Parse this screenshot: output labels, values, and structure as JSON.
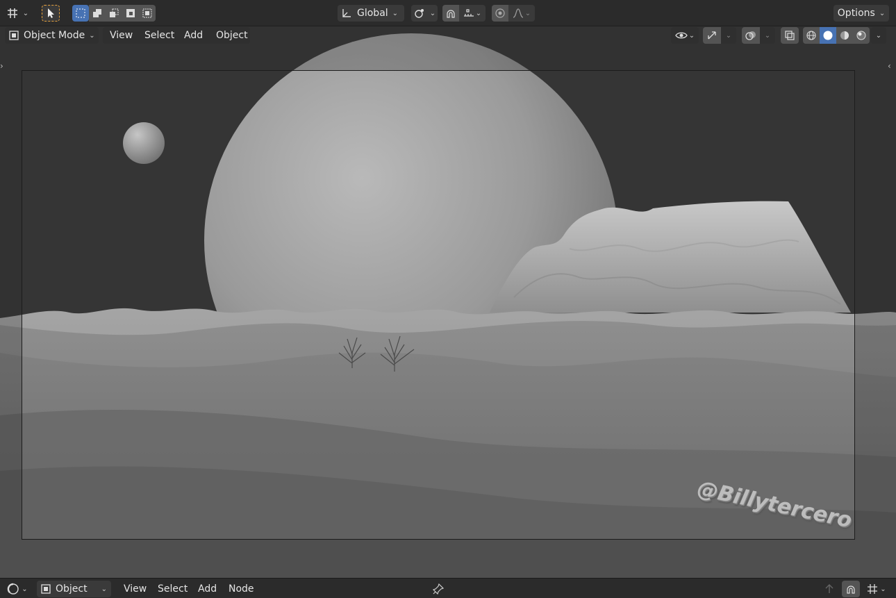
{
  "top_header": {
    "transform_orientation": "Global",
    "options_label": "Options"
  },
  "mode_bar": {
    "mode_label": "Object Mode",
    "menus": [
      "View",
      "Select",
      "Add",
      "Object"
    ]
  },
  "viewport": {
    "watermark_text": "@Billytercero"
  },
  "bottom_bar": {
    "editor_mode_label": "Object",
    "menus": [
      "View",
      "Select",
      "Add",
      "Node"
    ]
  },
  "colors": {
    "header_bg": "#2b2b2b",
    "button_bg": "#545454",
    "active_blue": "#4772b3",
    "select_tool_orange": "#e8a33d",
    "viewport_bg": "#3e3e3e"
  },
  "icons": {
    "editor_type": "grid-axes-icon",
    "select_tool": "cursor-arrow-icon",
    "select_modes": [
      "select-new-icon",
      "select-extend-icon",
      "select-subtract-icon",
      "select-invert-icon",
      "select-intersect-icon"
    ],
    "transform_orientation": "axes-icon",
    "pivot": "pivot-point-icon",
    "snap": "magnet-icon",
    "snap_target": "snap-increment-icon",
    "proportional": "proportional-edit-icon",
    "falloff": "falloff-curve-icon",
    "visibility": "eye-icon",
    "gizmo": "gizmo-icon",
    "overlays": "overlay-icon",
    "xray": "xray-icon",
    "shading": [
      "wireframe-shading-icon",
      "solid-shading-icon",
      "material-shading-icon",
      "rendered-shading-icon"
    ],
    "node_editor": "node-editor-icon",
    "pin": "pin-icon"
  }
}
